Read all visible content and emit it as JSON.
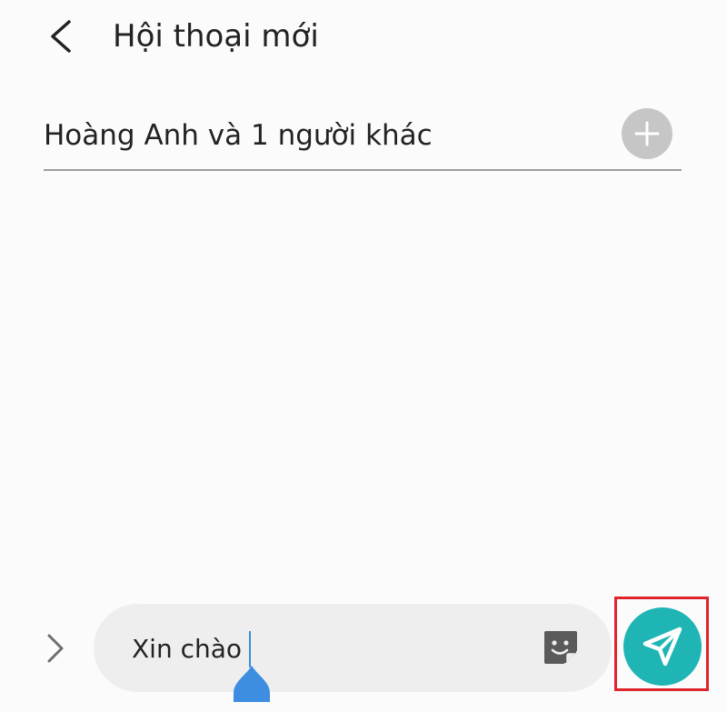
{
  "header": {
    "title": "Hội thoại mới",
    "back_icon": "chevron-left-icon"
  },
  "recipients": {
    "text": "Hoàng Anh và 1 người khác",
    "add_icon": "plus-icon"
  },
  "composer": {
    "expand_icon": "chevron-right-icon",
    "message_value": "Xin chào",
    "sticker_icon": "sticker-icon",
    "send_icon": "send-icon"
  },
  "colors": {
    "accent": "#1fb5b5",
    "add_button": "#c6c6c6",
    "highlight": "#e0242b",
    "cursor": "#3d8ee0"
  }
}
